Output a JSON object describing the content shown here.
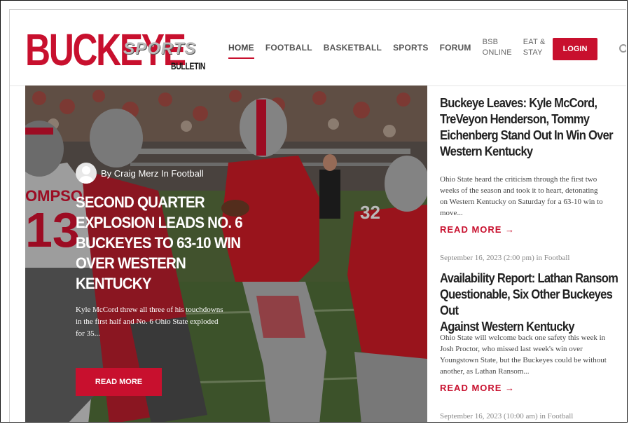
{
  "logo": {
    "main": "BUCKEYE",
    "sports": "SPORTS",
    "bulletin": "BULLETIN"
  },
  "nav": {
    "items": [
      "HOME",
      "FOOTBALL",
      "BASKETBALL",
      "SPORTS",
      "FORUM"
    ],
    "bsb_line1": "BSB",
    "bsb_line2": "ONLINE",
    "eat_line1": "EAT &",
    "eat_line2": "STAY",
    "login": "LOGIN",
    "active_color": "#c8102e"
  },
  "hero": {
    "byline": "By Craig Merz In Football",
    "title": "SECOND QUARTER EXPLOSION LEADS NO. 6 BUCKEYES TO 63-10 WIN OVER WESTERN KENTUCKY",
    "excerpt": "Kyle McCord threw all three of his touchdowns in the first half and No. 6 Ohio State exploded for 35...",
    "button": "READ MORE",
    "jersey_left": "13",
    "jersey_name": "OMPSON",
    "jersey_right": "32"
  },
  "sidebar": {
    "articles": [
      {
        "title": "Buckeye Leaves: Kyle McCord,\nTreVeyon Henderson, Tommy\nEichenberg Stand Out In Win Over\nWestern Kentucky",
        "excerpt": "Ohio State heard the criticism through the first two\nweeks of the season and took it to heart, detonating\non Western Kentucky on Saturday for a 63-10 win to\nmove...",
        "read_more": "READ MORE →"
      },
      {
        "date": "September 16, 2023 (2:00 pm) in Football",
        "title": "Availability Report: Lathan Ransom\nQuestionable, Six Other Buckeyes Out\nAgainst Western Kentucky",
        "excerpt": "Ohio State will welcome back one safety this week in\nJosh Proctor, who missed last week's win over\nYoungstown State, but the Buckeyes could be without\nanother, as Lathan Ransom...",
        "read_more": "READ MORE →"
      }
    ],
    "bottom_date": "September 16, 2023 (10:00 am) in Football"
  },
  "colors": {
    "brand_red": "#c8102e",
    "title_text": "#222222"
  }
}
